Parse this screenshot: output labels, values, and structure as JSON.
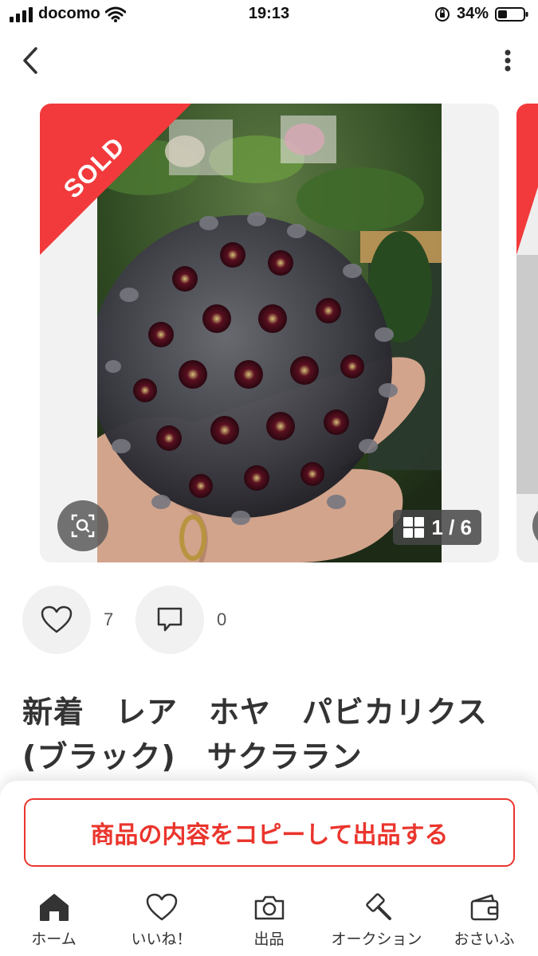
{
  "status_bar": {
    "carrier": "docomo",
    "time": "19:13",
    "battery": "34%"
  },
  "nav": {
    "back_icon": "chevron-left-icon",
    "more_icon": "more-vertical-icon"
  },
  "gallery": {
    "sold_label": "SOLD",
    "counter": "1 / 6",
    "current_index": 1,
    "total": 6,
    "sold_color": "#f23a3c"
  },
  "actions": {
    "likes_count": "7",
    "comments_count": "0"
  },
  "item": {
    "title": "新着　レア　ホヤ　パビカリクス　(ブラック)　サクララン"
  },
  "copy_button": {
    "label": "商品の内容をコピーして出品する",
    "color": "#ea352d"
  },
  "tabbar": {
    "items": [
      {
        "label": "ホーム",
        "icon": "home-icon"
      },
      {
        "label": "いいね！",
        "icon": "heart-icon"
      },
      {
        "label": "出品",
        "icon": "camera-icon"
      },
      {
        "label": "オークション",
        "icon": "gavel-icon"
      },
      {
        "label": "おさいふ",
        "icon": "wallet-icon"
      }
    ]
  }
}
